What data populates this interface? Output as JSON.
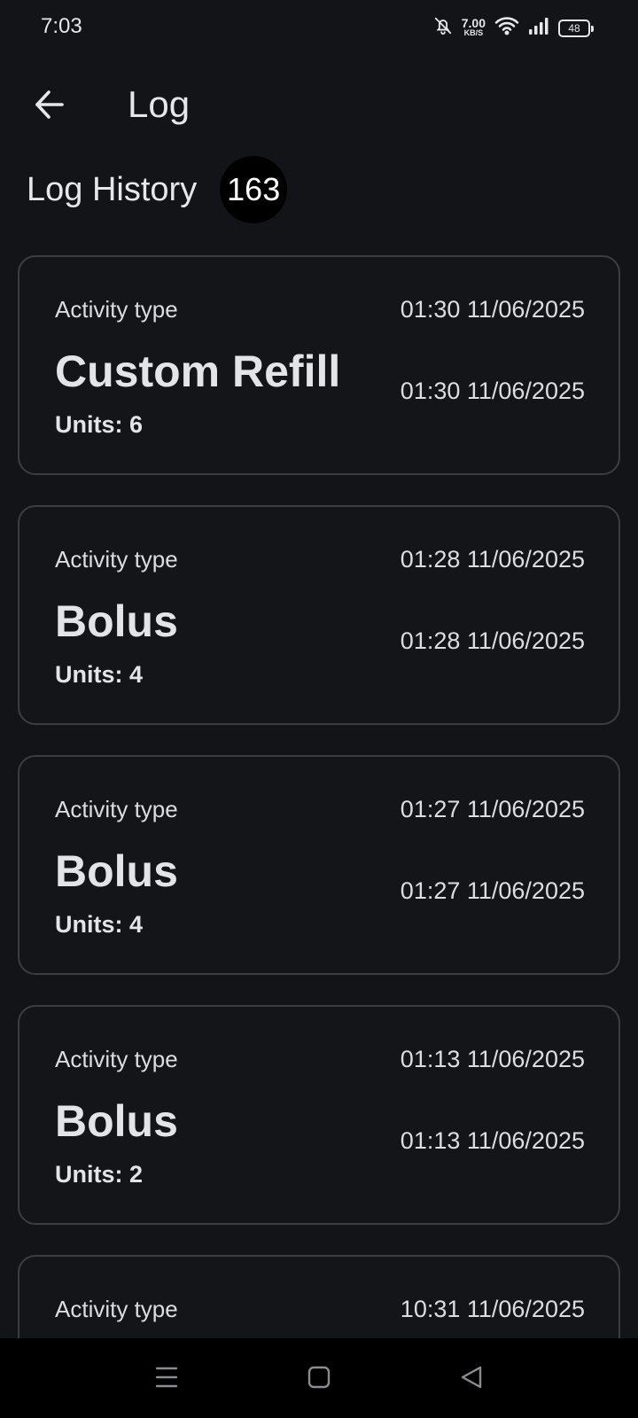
{
  "status_bar": {
    "time": "7:03",
    "net_speed_value": "7.00",
    "net_speed_unit": "KB/S",
    "battery": "48",
    "icons": [
      "bell-off-icon",
      "wifi-icon",
      "signal-icon",
      "battery-icon"
    ]
  },
  "app_bar": {
    "title": "Log",
    "back_icon": "arrow-left-icon"
  },
  "header": {
    "title": "Log History",
    "count": "163"
  },
  "logs": [
    {
      "label": "Activity type",
      "activity": "Custom Refill",
      "units": "Units: 6",
      "timestamp_1": "01:30 11/06/2025",
      "timestamp_2": "01:30 11/06/2025"
    },
    {
      "label": "Activity type",
      "activity": "Bolus",
      "units": "Units: 4",
      "timestamp_1": "01:28 11/06/2025",
      "timestamp_2": "01:28 11/06/2025"
    },
    {
      "label": "Activity type",
      "activity": "Bolus",
      "units": "Units: 4",
      "timestamp_1": "01:27 11/06/2025",
      "timestamp_2": "01:27 11/06/2025"
    },
    {
      "label": "Activity type",
      "activity": "Bolus",
      "units": "Units: 2",
      "timestamp_1": "01:13 11/06/2025",
      "timestamp_2": "01:13 11/06/2025"
    },
    {
      "label": "Activity type",
      "activity": "",
      "units": "",
      "timestamp_1": "10:31 11/06/2025",
      "timestamp_2": ""
    }
  ],
  "nav_bar": {
    "icons": [
      "menu-icon",
      "home-square-icon",
      "back-triangle-icon"
    ]
  },
  "colors": {
    "background": "#121418",
    "text": "#e6e7ea",
    "card_border": "#3a3d42",
    "badge": "#000000",
    "nav_bar": "#000000"
  }
}
